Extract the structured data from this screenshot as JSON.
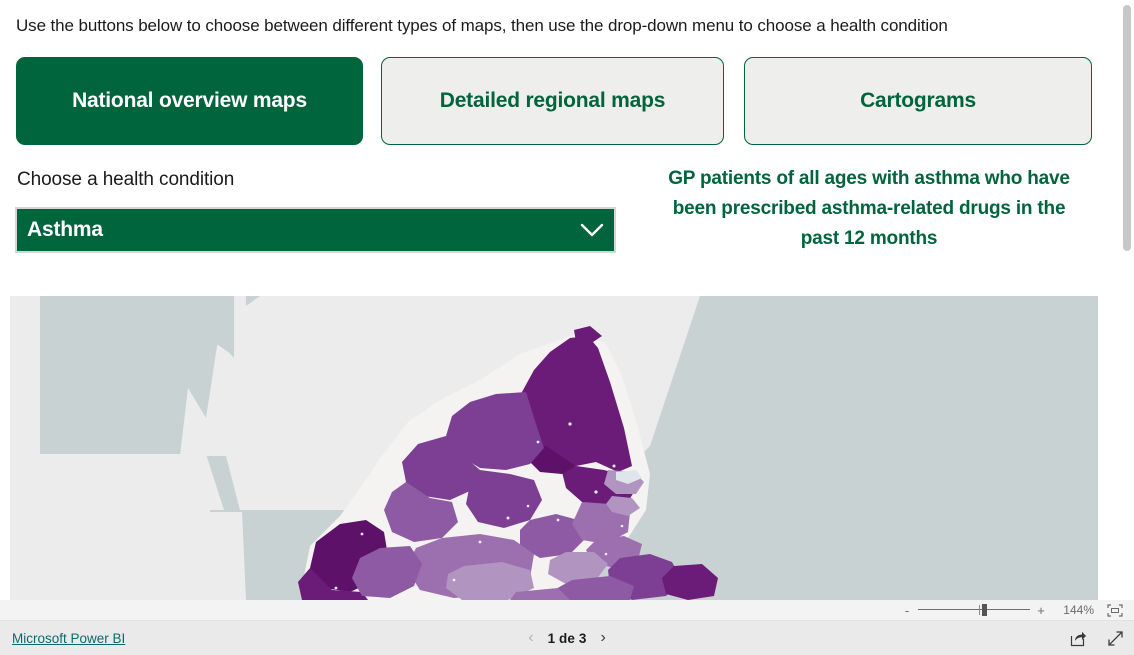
{
  "instruction": "Use the buttons below to choose between different types of maps, then use the drop-down menu to choose a health condition",
  "nav_buttons": [
    {
      "label": "National overview maps",
      "state": "active"
    },
    {
      "label": "Detailed regional maps",
      "state": "inactive"
    },
    {
      "label": "Cartograms",
      "state": "inactive"
    }
  ],
  "filter": {
    "label": "Choose a health condition",
    "selected": "Asthma",
    "chevron_icon": "chevron-down-icon"
  },
  "report_title": "GP patients of all ages with asthma who have been prescribed asthma-related drugs in the past 12 months",
  "map": {
    "type": "choropleth",
    "region": "North East England",
    "sea_color": "#c9d2d3",
    "land_color": "#ececec",
    "coast_outline": "#f2f2f0",
    "palette": [
      "#dfe5ea",
      "#b294c0",
      "#9c6fae",
      "#8e5aa3",
      "#7d3f94",
      "#6b1b78",
      "#5d1168"
    ]
  },
  "zoom_bar": {
    "minus_label": "-",
    "plus_label": "+",
    "percent": "144%",
    "fit_icon": "fit-to-page-icon",
    "slider_value": 57
  },
  "footer": {
    "brand": "Microsoft Power BI",
    "prev_icon": "chevron-left-icon",
    "next_icon": "chevron-right-icon",
    "page_text": "1 de 3",
    "share_icon": "share-icon",
    "fullscreen_icon": "fullscreen-icon"
  },
  "colors": {
    "brand_green": "#00643c",
    "link_teal": "#0b6a6e",
    "button_inactive_bg": "#eeeeec"
  }
}
